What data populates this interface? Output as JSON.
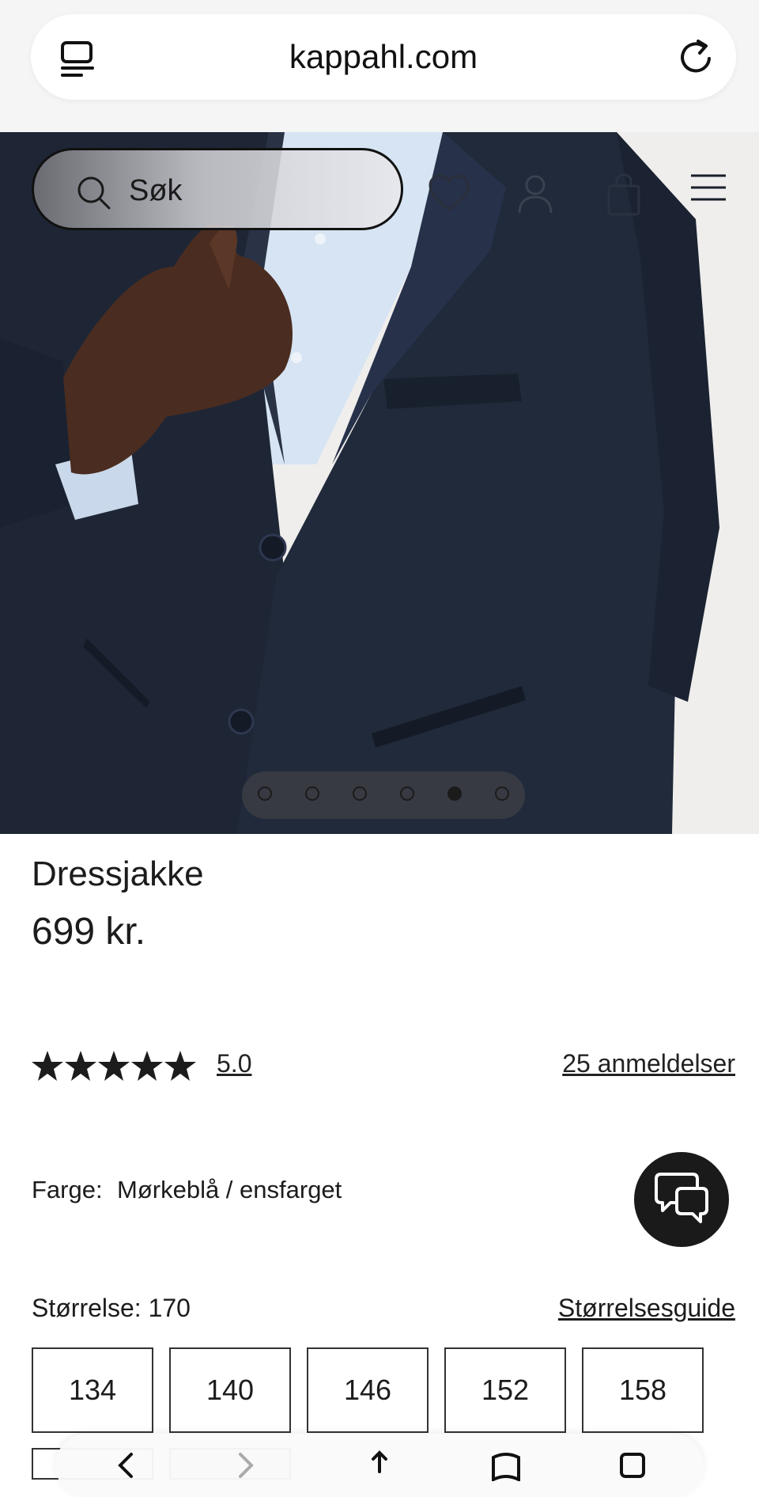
{
  "browser": {
    "url": "kappahl.com",
    "icons": [
      "tabs-icon",
      "reload-icon"
    ]
  },
  "header": {
    "search_placeholder": "Søk",
    "icons": [
      "search-icon",
      "heart-icon",
      "user-icon",
      "bag-icon",
      "menu-icon"
    ]
  },
  "gallery": {
    "dot_count": 6,
    "active_index": 4
  },
  "product": {
    "title": "Dressjakke",
    "price": "699 kr."
  },
  "rating": {
    "stars": 5,
    "value": "5.0",
    "reviews_link": "25 anmeldelser"
  },
  "color": {
    "label": "Farge:",
    "value": "Mørkeblå / ensfarget"
  },
  "size": {
    "label": "Størrelse: 170",
    "guide_link": "Størrelsesguide",
    "options": [
      "134",
      "140",
      "146",
      "152",
      "158"
    ]
  },
  "colors": {
    "jacket": "#1e2635",
    "shirt": "#d6e4f3",
    "skin": "#4a2c20",
    "text": "#1c1c1c"
  }
}
